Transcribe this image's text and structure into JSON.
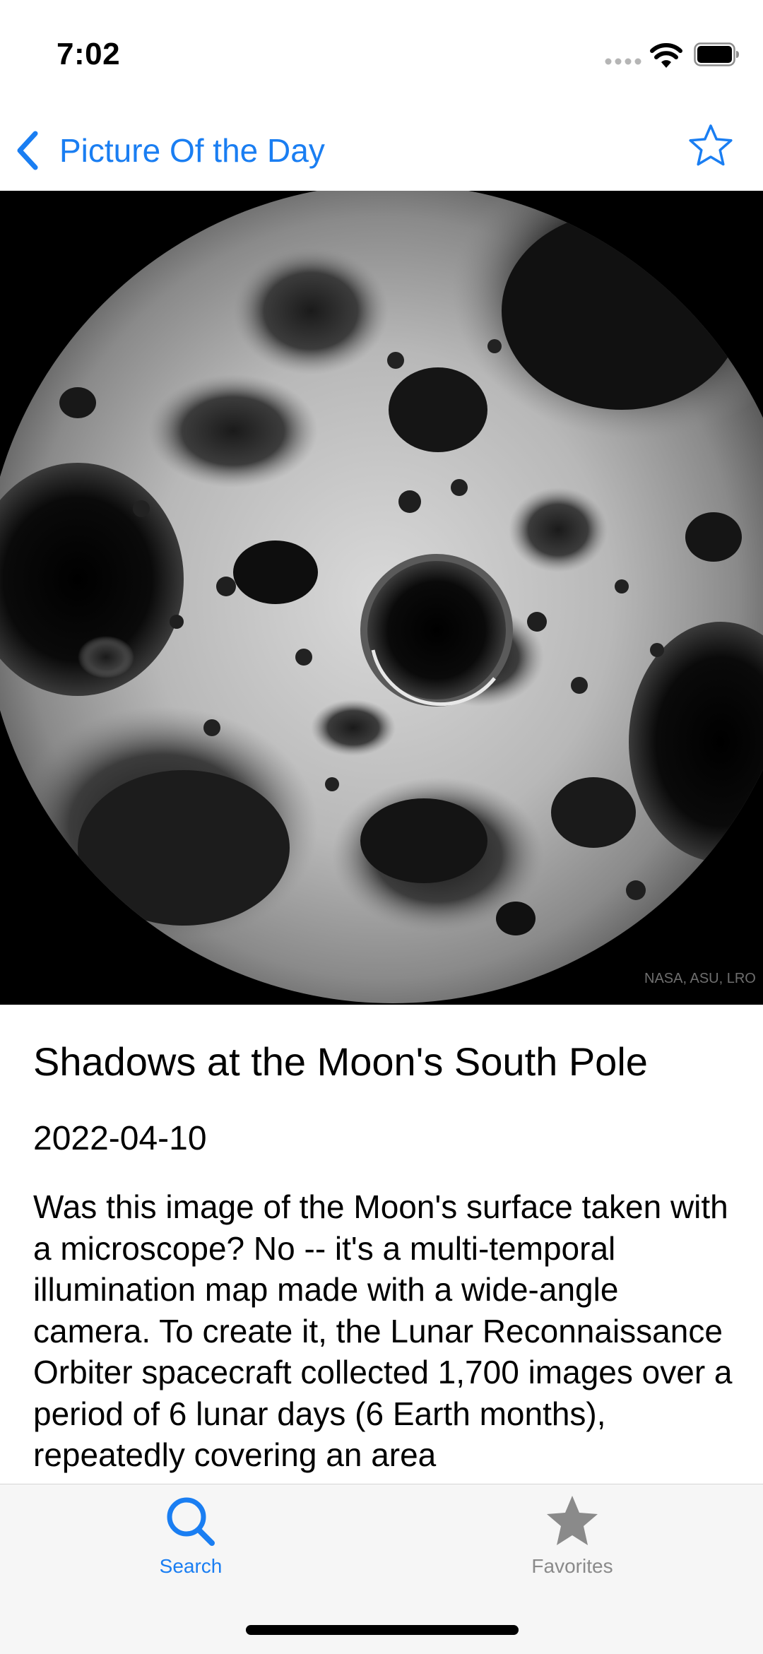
{
  "status_bar": {
    "time": "7:02",
    "icons": [
      "cellular-signal-icon",
      "wifi-icon",
      "battery-icon"
    ]
  },
  "nav": {
    "back_label": "Picture Of the Day",
    "back_icon": "chevron-left-icon",
    "favorite_icon": "star-outline-icon",
    "accent_color": "#1a7ef2"
  },
  "image": {
    "description_hidden": true,
    "credit": "NASA, ASU, LRO"
  },
  "apod": {
    "title": "Shadows at the Moon's South Pole",
    "date": "2022-04-10",
    "explanation": "Was this image of the Moon's surface taken with a microscope? No -- it's a multi-temporal illumination map made with a wide-angle camera.  To create it, the Lunar Reconnaissance Orbiter spacecraft collected 1,700 images over a period of 6 lunar days (6 Earth months), repeatedly covering an area"
  },
  "tab_bar": {
    "tabs": [
      {
        "label": "Search",
        "icon": "search-icon",
        "selected": true
      },
      {
        "label": "Favorites",
        "icon": "star-filled-icon",
        "selected": false
      }
    ]
  }
}
